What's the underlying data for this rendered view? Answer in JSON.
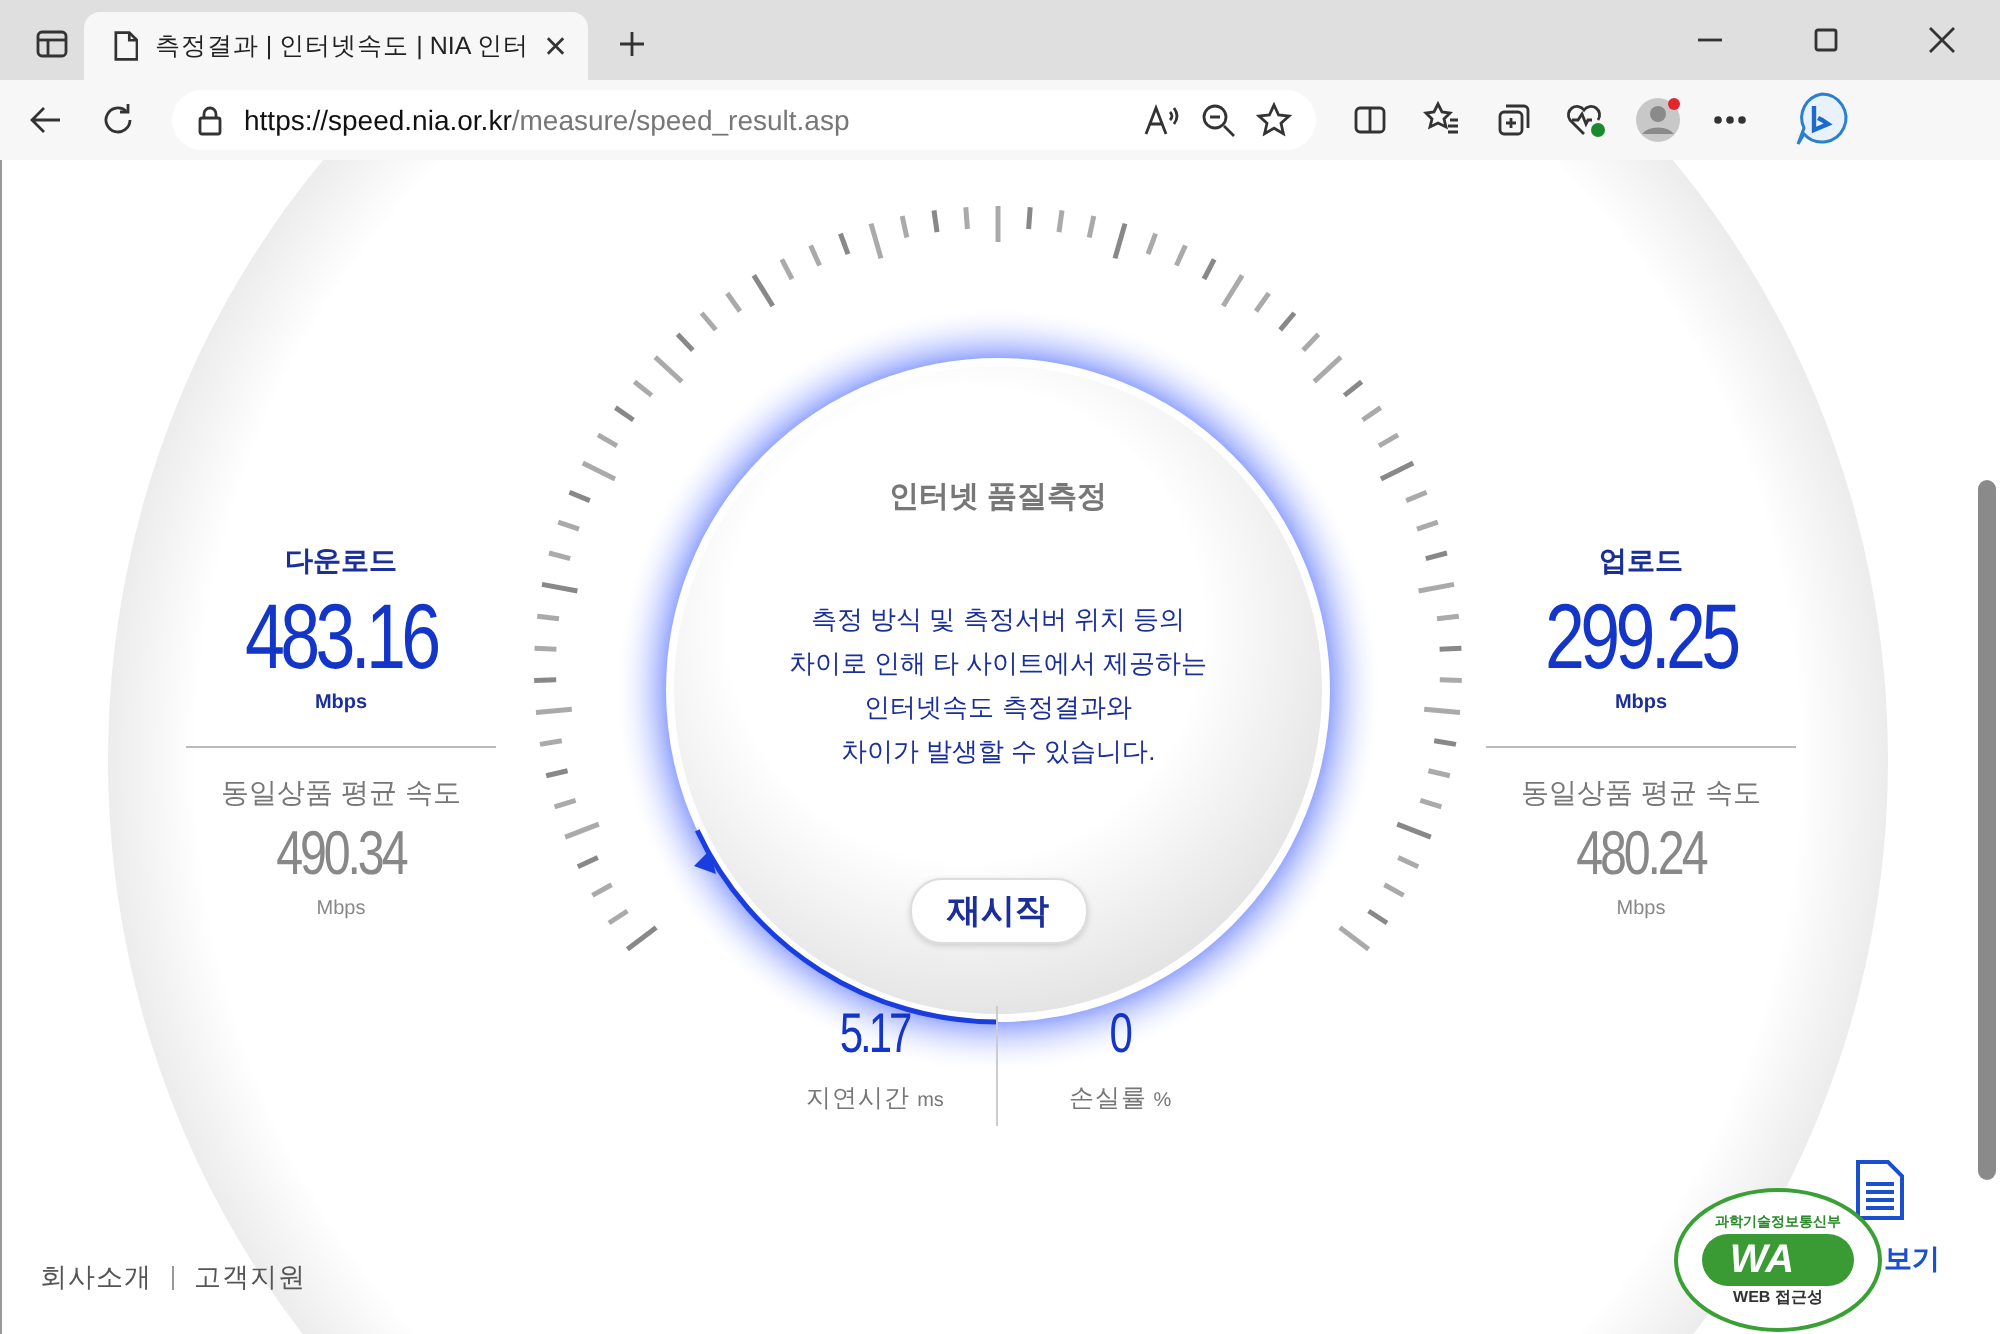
{
  "browser": {
    "tab_title": "측정결과 | 인터넷속도 | NIA 인터",
    "url_host": "https://speed.nia.or.kr",
    "url_path": "/measure/speed_result.asp"
  },
  "title": "인터넷 품질측정",
  "notice": [
    "측정 방식 및 측정서버 위치 등의",
    "차이로 인해 타 사이트에서 제공하는",
    "인터넷속도 측정결과와",
    "차이가 발생할 수 있습니다."
  ],
  "restart_button": "재시작",
  "speeds": [
    {
      "label": "다운로드",
      "value": "483.16",
      "unit": "Mbps",
      "avg_label": "동일상품 평균 속도",
      "avg_value": "490.34",
      "avg_unit": "Mbps"
    },
    {
      "label": "업로드",
      "value": "299.25",
      "unit": "Mbps",
      "avg_label": "동일상품 평균 속도",
      "avg_value": "480.24",
      "avg_unit": "Mbps"
    }
  ],
  "stats": [
    {
      "value": "5.17",
      "label": "지연시간",
      "unit": "ms"
    },
    {
      "value": "0",
      "label": "손실률",
      "unit": "%"
    }
  ],
  "footer_links": [
    "회사소개",
    "고객지원"
  ],
  "report_link": "보기",
  "badge": {
    "ministry": "과학기술정보통신부",
    "mark": "WA",
    "caption": "WEB 접근성"
  }
}
